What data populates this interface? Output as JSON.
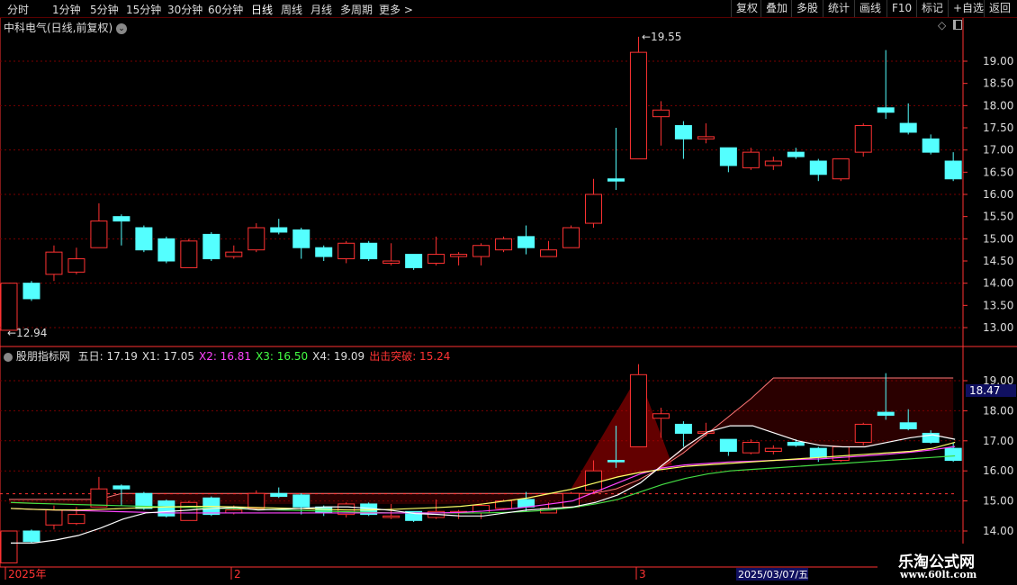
{
  "toolbar": {
    "periods": [
      "分时",
      "1分钟",
      "5分钟",
      "15分钟",
      "30分钟",
      "60分钟",
      "日线",
      "周线",
      "月线",
      "多周期",
      "更多"
    ],
    "active": "日线",
    "more_chevron": "chevron-right-icon",
    "right": [
      "复权",
      "叠加",
      "多股",
      "统计",
      "画线",
      "F10",
      "标记",
      "+自选",
      "返回"
    ]
  },
  "main_panel": {
    "title": "中科电气(日线,前复权)",
    "title_dropdown_icon": "chevron-down-icon",
    "right_icons": [
      "diamond-icon",
      "panel-toggle-icon"
    ],
    "price_axis": [
      "19.00",
      "18.50",
      "18.00",
      "17.50",
      "17.00",
      "16.50",
      "16.00",
      "15.50",
      "15.00",
      "14.50",
      "14.00",
      "13.50",
      "13.00"
    ],
    "high_label": "19.55",
    "low_label": "12.94"
  },
  "indicator_panel": {
    "name": "股朋指标网",
    "values": [
      {
        "label": "五日:",
        "value": "17.19",
        "color": "#dddddd"
      },
      {
        "label": "X1:",
        "value": "17.05",
        "color": "#dddddd"
      },
      {
        "label": "X2:",
        "value": "16.81",
        "color": "#ff44ff"
      },
      {
        "label": "X3:",
        "value": "16.50",
        "color": "#44ff44"
      },
      {
        "label": "X4:",
        "value": "19.09",
        "color": "#dddddd"
      },
      {
        "label": "出击突破:",
        "value": "15.24",
        "color": "#ff3333"
      }
    ],
    "axis": [
      "19.00",
      "18.00",
      "17.00",
      "16.00",
      "15.00",
      "14.00"
    ],
    "current_label": "18.47"
  },
  "date_axis": {
    "labels": [
      "2025年",
      "2",
      "3"
    ],
    "cursor_date": "2025/03/07/五"
  },
  "watermark": {
    "line1": "乐淘公式网",
    "line2": "www.60lt.com"
  },
  "colors": {
    "up": "#ff3232",
    "down": "#54ffff",
    "grid": "#7a0000",
    "axis": "#ff3232"
  },
  "chart_data": {
    "type": "candlestick",
    "candles": [
      {
        "o": 12.94,
        "c": 14.0,
        "h": 14.0,
        "l": 12.94
      },
      {
        "o": 14.0,
        "c": 13.65,
        "h": 14.05,
        "l": 13.6
      },
      {
        "o": 14.2,
        "c": 14.7,
        "h": 14.85,
        "l": 14.05
      },
      {
        "o": 14.25,
        "c": 14.55,
        "h": 14.8,
        "l": 14.2
      },
      {
        "o": 14.8,
        "c": 15.4,
        "h": 15.8,
        "l": 14.8
      },
      {
        "o": 15.5,
        "c": 15.4,
        "h": 15.55,
        "l": 14.85
      },
      {
        "o": 15.25,
        "c": 14.75,
        "h": 15.3,
        "l": 14.7
      },
      {
        "o": 15.0,
        "c": 14.5,
        "h": 15.05,
        "l": 14.45
      },
      {
        "o": 14.35,
        "c": 14.95,
        "h": 15.0,
        "l": 14.35
      },
      {
        "o": 15.1,
        "c": 14.55,
        "h": 15.15,
        "l": 14.5
      },
      {
        "o": 14.6,
        "c": 14.7,
        "h": 14.85,
        "l": 14.55
      },
      {
        "o": 14.75,
        "c": 15.25,
        "h": 15.35,
        "l": 14.7
      },
      {
        "o": 15.25,
        "c": 15.15,
        "h": 15.45,
        "l": 15.1
      },
      {
        "o": 15.2,
        "c": 14.8,
        "h": 15.25,
        "l": 14.55
      },
      {
        "o": 14.8,
        "c": 14.6,
        "h": 14.85,
        "l": 14.5
      },
      {
        "o": 14.55,
        "c": 14.9,
        "h": 14.95,
        "l": 14.45
      },
      {
        "o": 14.9,
        "c": 14.55,
        "h": 14.95,
        "l": 14.5
      },
      {
        "o": 14.45,
        "c": 14.5,
        "h": 14.9,
        "l": 14.4
      },
      {
        "o": 14.65,
        "c": 14.35,
        "h": 14.65,
        "l": 14.3
      },
      {
        "o": 14.45,
        "c": 14.65,
        "h": 15.05,
        "l": 14.4
      },
      {
        "o": 14.6,
        "c": 14.65,
        "h": 14.7,
        "l": 14.4
      },
      {
        "o": 14.6,
        "c": 14.85,
        "h": 14.9,
        "l": 14.4
      },
      {
        "o": 14.75,
        "c": 15.0,
        "h": 15.05,
        "l": 14.7
      },
      {
        "o": 15.05,
        "c": 14.8,
        "h": 15.3,
        "l": 14.65
      },
      {
        "o": 14.6,
        "c": 14.75,
        "h": 14.95,
        "l": 14.6
      },
      {
        "o": 14.8,
        "c": 15.25,
        "h": 15.3,
        "l": 14.8
      },
      {
        "o": 15.35,
        "c": 16.0,
        "h": 16.35,
        "l": 15.25
      },
      {
        "o": 16.35,
        "c": 16.3,
        "h": 17.5,
        "l": 16.1
      },
      {
        "o": 16.8,
        "c": 19.2,
        "h": 19.55,
        "l": 16.8
      },
      {
        "o": 17.75,
        "c": 17.9,
        "h": 18.1,
        "l": 17.1
      },
      {
        "o": 17.55,
        "c": 17.25,
        "h": 17.65,
        "l": 16.8
      },
      {
        "o": 17.25,
        "c": 17.3,
        "h": 17.6,
        "l": 17.15
      },
      {
        "o": 17.05,
        "c": 16.65,
        "h": 17.05,
        "l": 16.5
      },
      {
        "o": 16.6,
        "c": 16.95,
        "h": 17.05,
        "l": 16.55
      },
      {
        "o": 16.65,
        "c": 16.75,
        "h": 16.85,
        "l": 16.55
      },
      {
        "o": 16.95,
        "c": 16.85,
        "h": 17.05,
        "l": 16.8
      },
      {
        "o": 16.75,
        "c": 16.45,
        "h": 16.8,
        "l": 16.3
      },
      {
        "o": 16.35,
        "c": 16.8,
        "h": 16.8,
        "l": 16.3
      },
      {
        "o": 16.95,
        "c": 17.55,
        "h": 17.6,
        "l": 16.85
      },
      {
        "o": 17.95,
        "c": 17.85,
        "h": 19.25,
        "l": 17.7
      },
      {
        "o": 17.6,
        "c": 17.4,
        "h": 18.05,
        "l": 17.35
      },
      {
        "o": 17.25,
        "c": 16.95,
        "h": 17.35,
        "l": 16.9
      },
      {
        "o": 16.75,
        "c": 16.35,
        "h": 16.95,
        "l": 16.3
      }
    ],
    "ma_white": [
      13.6,
      13.6,
      13.7,
      13.85,
      14.1,
      14.4,
      14.6,
      14.65,
      14.7,
      14.75,
      14.78,
      14.7,
      14.72,
      14.75,
      14.8,
      14.8,
      14.75,
      14.68,
      14.58,
      14.55,
      14.5,
      14.5,
      14.6,
      14.7,
      14.75,
      14.8,
      14.95,
      15.2,
      15.6,
      16.2,
      16.8,
      17.3,
      17.5,
      17.5,
      17.25,
      17.0,
      16.85,
      16.8,
      16.8,
      16.95,
      17.1,
      17.2,
      17.05
    ],
    "ma_yellow": [
      14.75,
      14.72,
      14.7,
      14.7,
      14.72,
      14.75,
      14.78,
      14.8,
      14.82,
      14.82,
      14.8,
      14.78,
      14.76,
      14.74,
      14.72,
      14.7,
      14.7,
      14.72,
      14.75,
      14.78,
      14.82,
      14.9,
      15.0,
      15.1,
      15.25,
      15.4,
      15.6,
      15.8,
      15.95,
      16.05,
      16.15,
      16.2,
      16.25,
      16.3,
      16.35,
      16.4,
      16.45,
      16.5,
      16.55,
      16.6,
      16.65,
      16.75,
      16.95
    ],
    "ma_magenta": [
      14.75,
      14.72,
      14.7,
      14.68,
      14.66,
      14.64,
      14.62,
      14.6,
      14.6,
      14.6,
      14.6,
      14.6,
      14.6,
      14.6,
      14.6,
      14.6,
      14.6,
      14.6,
      14.6,
      14.6,
      14.62,
      14.66,
      14.72,
      14.8,
      14.9,
      15.0,
      15.3,
      15.6,
      15.9,
      16.1,
      16.2,
      16.25,
      16.3,
      16.32,
      16.35,
      16.38,
      16.4,
      16.45,
      16.5,
      16.55,
      16.62,
      16.7,
      16.81
    ],
    "ma_green": [
      14.95,
      14.92,
      14.9,
      14.88,
      14.86,
      14.84,
      14.82,
      14.8,
      14.78,
      14.76,
      14.74,
      14.72,
      14.7,
      14.68,
      14.66,
      14.64,
      14.62,
      14.6,
      14.6,
      14.6,
      14.6,
      14.6,
      14.62,
      14.65,
      14.7,
      14.78,
      14.9,
      15.05,
      15.3,
      15.55,
      15.75,
      15.9,
      16.0,
      16.05,
      16.1,
      16.15,
      16.2,
      16.25,
      16.3,
      16.35,
      16.4,
      16.45,
      16.5
    ],
    "x4_envelope": [
      15.05,
      15.05,
      15.05,
      15.05,
      15.05,
      15.25,
      15.25,
      15.25,
      15.25,
      15.25,
      15.25,
      15.25,
      15.25,
      15.25,
      15.25,
      15.25,
      15.25,
      15.25,
      15.25,
      15.25,
      15.25,
      15.25,
      15.25,
      15.25,
      15.25,
      15.25,
      15.25,
      15.4,
      15.7,
      16.1,
      16.6,
      17.2,
      17.8,
      18.4,
      19.09,
      19.09,
      19.09,
      19.09,
      19.09,
      19.09,
      19.09,
      19.09,
      19.09
    ],
    "breakout_level": 15.24
  }
}
